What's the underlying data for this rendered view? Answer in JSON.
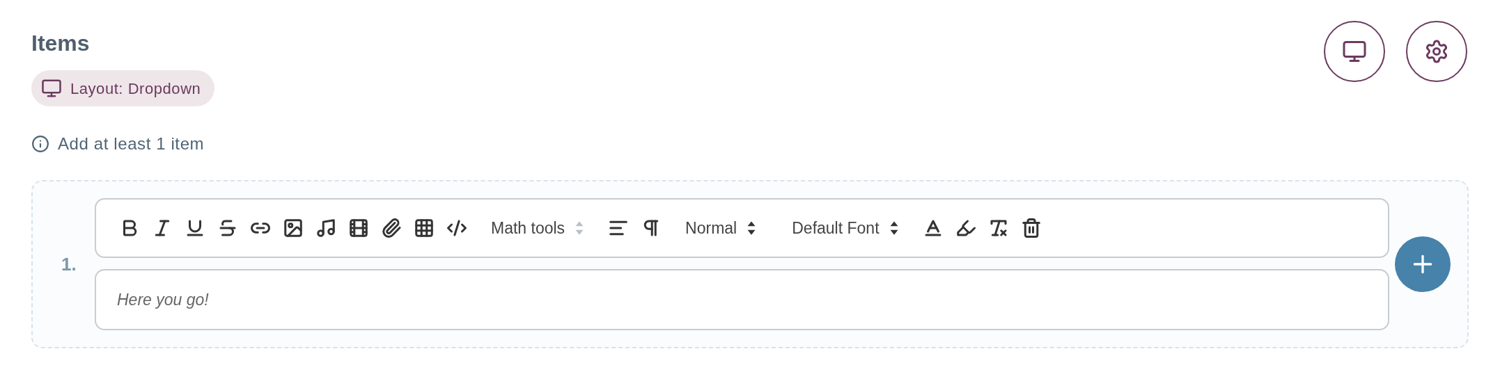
{
  "title": "Items",
  "layout_badge": {
    "label": "Layout: Dropdown"
  },
  "hint": "Add at least 1 item",
  "items": [
    {
      "number": "1.",
      "toolbar": [
        {
          "kind": "button"
        },
        {
          "kind": "button"
        },
        {
          "kind": "button"
        },
        {
          "kind": "button"
        },
        {
          "kind": "button"
        },
        {
          "kind": "button"
        },
        {
          "kind": "button"
        },
        {
          "kind": "button"
        },
        {
          "kind": "button"
        },
        {
          "kind": "button"
        },
        {
          "kind": "button"
        },
        {
          "kind": "select",
          "label": "Math tools",
          "disabled": true
        },
        {
          "kind": "button"
        },
        {
          "kind": "button"
        },
        {
          "kind": "select",
          "label": "Normal",
          "disabled": false
        },
        {
          "kind": "select",
          "label": "Default Font",
          "disabled": false
        },
        {
          "kind": "button"
        },
        {
          "kind": "button"
        },
        {
          "kind": "button"
        },
        {
          "kind": "button"
        }
      ],
      "placeholder": "Here you go!"
    }
  ]
}
